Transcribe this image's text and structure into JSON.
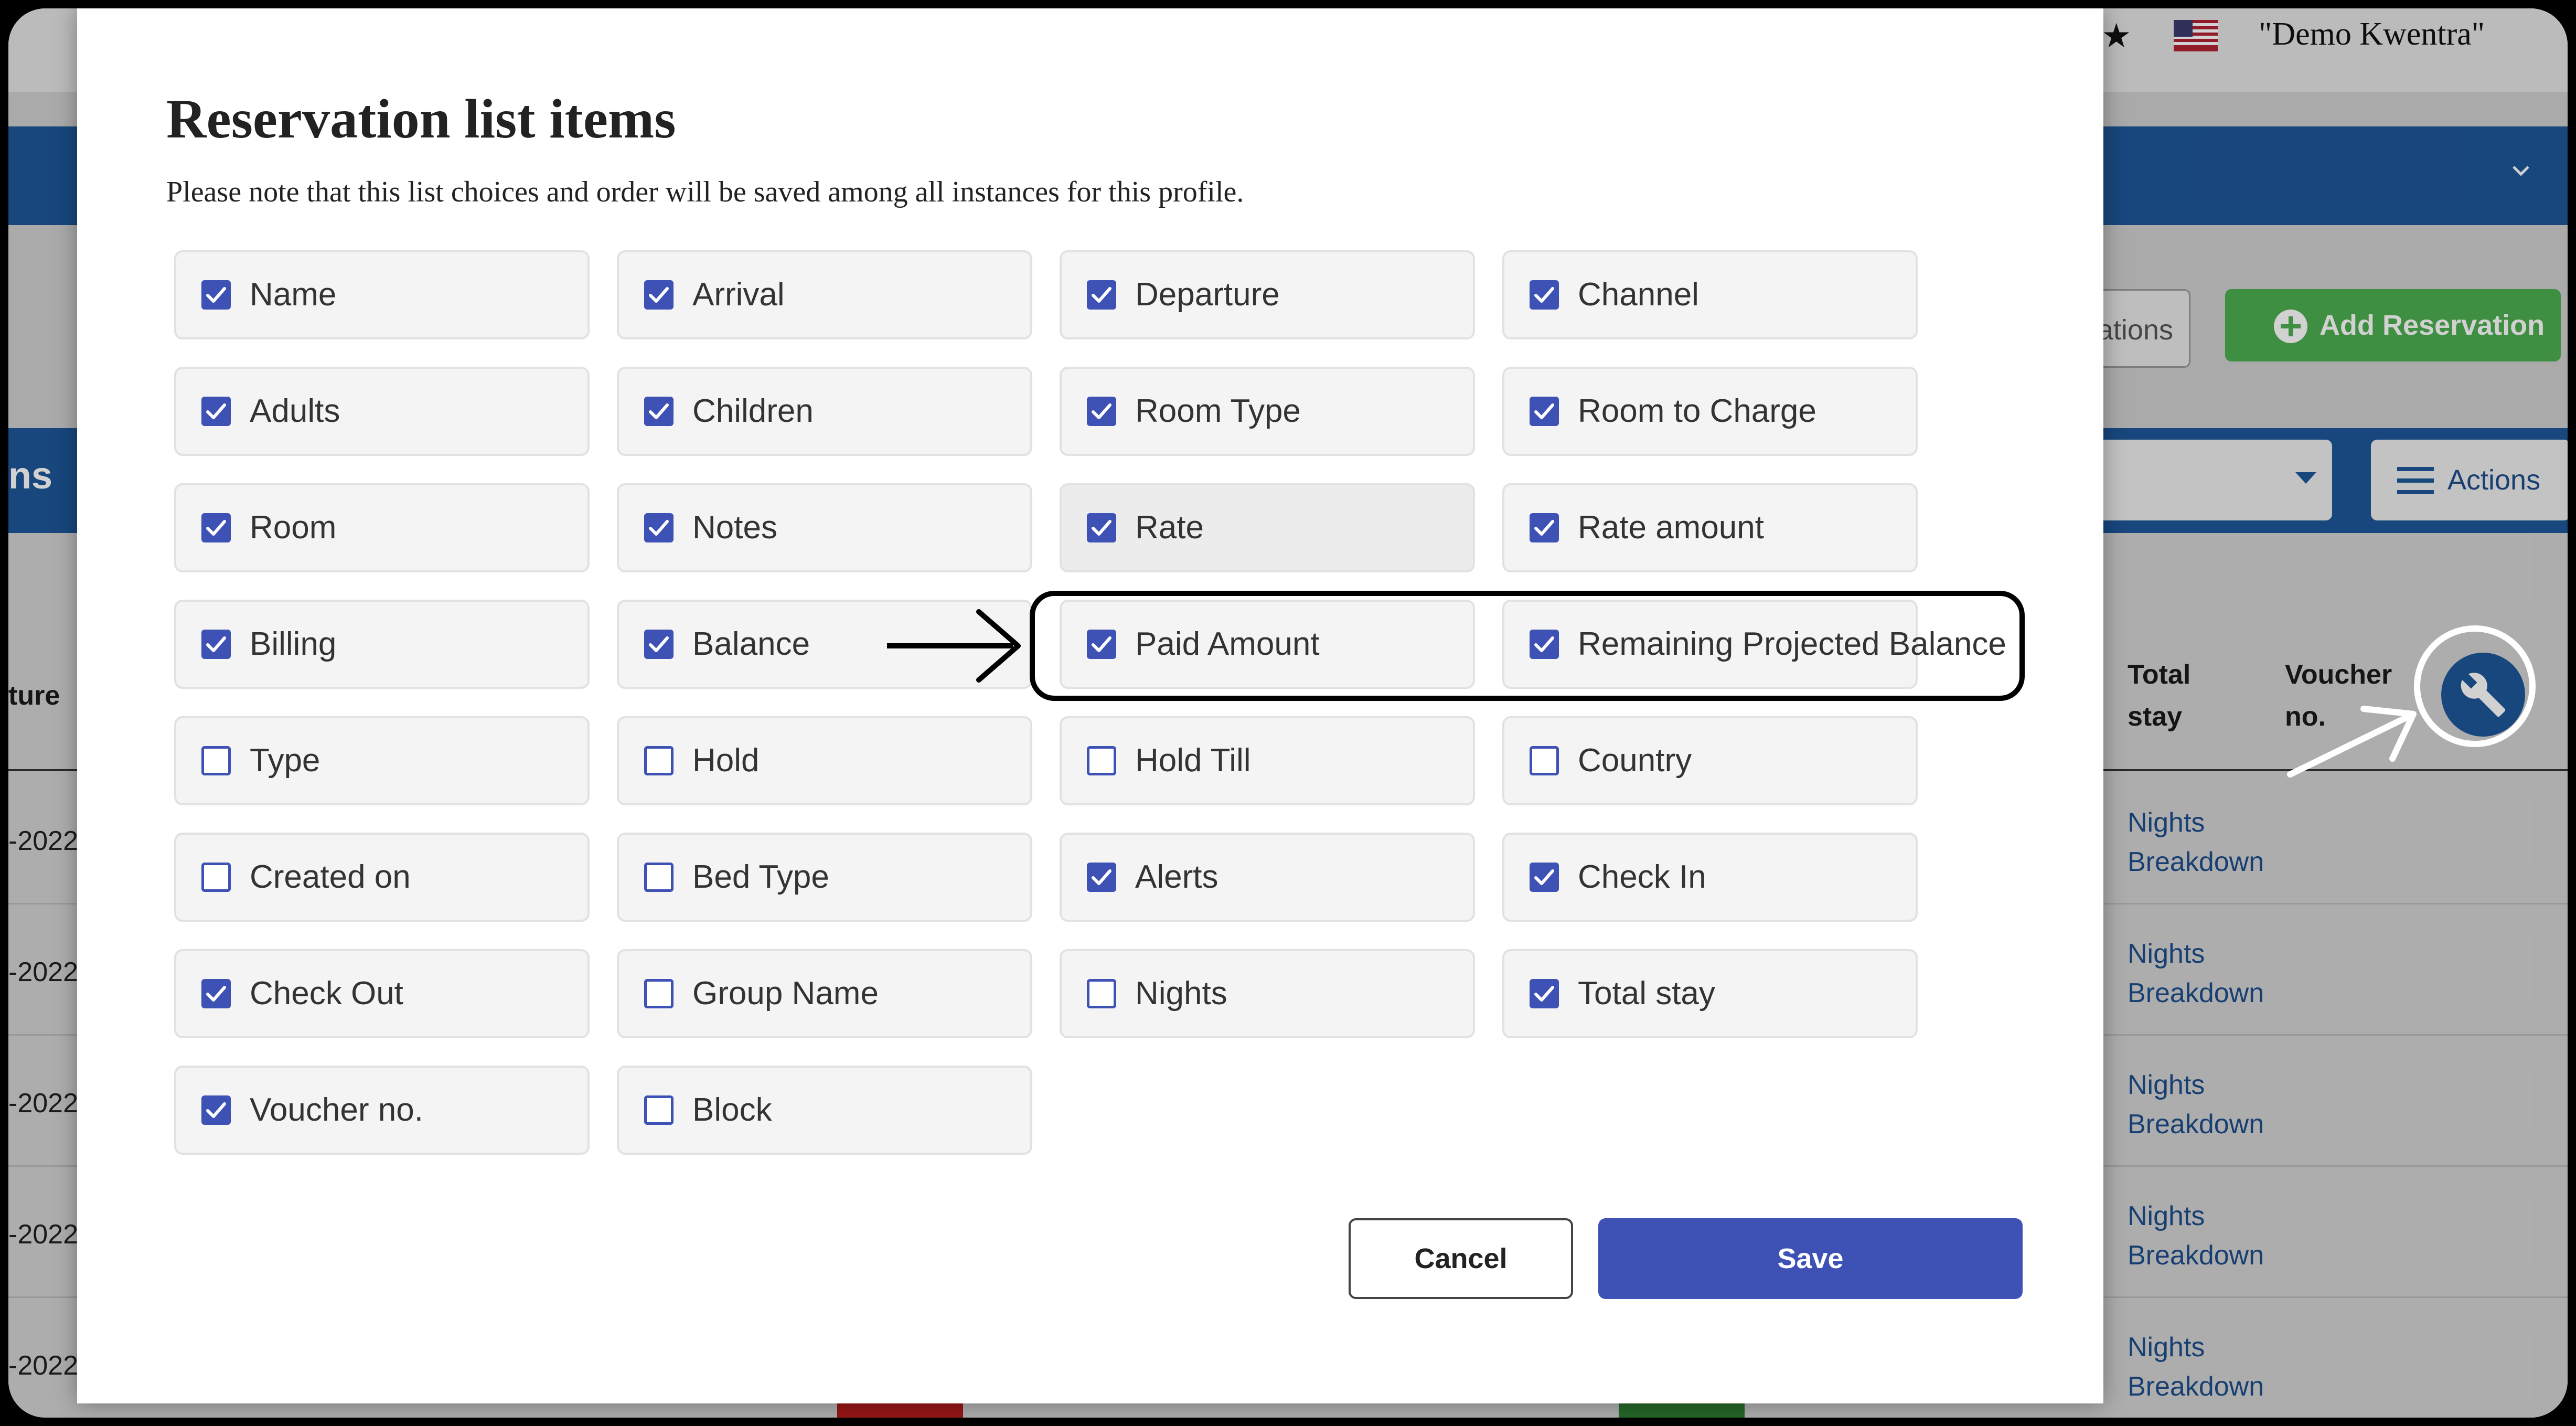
{
  "background": {
    "header_star": "★",
    "profile_name": "\"Demo Kwentra\"",
    "reservations_partial": "ations",
    "add_reservation": "Add Reservation",
    "section_partial": "ns",
    "actions_label": "Actions",
    "col_total_stay": "Total stay",
    "col_voucher": "Voucher no.",
    "col_partial": "ture",
    "row_date_partial": "-2022",
    "nights_breakdown": "Nights Breakdown",
    "colors": {
      "blue": "#1e5799",
      "green": "#4caf50"
    }
  },
  "modal": {
    "title": "Reservation list items",
    "note": "Please note that this list choices and order will be saved among all instances for this profile.",
    "items": [
      {
        "label": "Name",
        "checked": true
      },
      {
        "label": "Arrival",
        "checked": true
      },
      {
        "label": "Departure",
        "checked": true
      },
      {
        "label": "Channel",
        "checked": true
      },
      {
        "label": "Adults",
        "checked": true
      },
      {
        "label": "Children",
        "checked": true
      },
      {
        "label": "Room Type",
        "checked": true
      },
      {
        "label": "Room to Charge",
        "checked": true
      },
      {
        "label": "Room",
        "checked": true
      },
      {
        "label": "Notes",
        "checked": true
      },
      {
        "label": "Rate",
        "checked": true
      },
      {
        "label": "Rate amount",
        "checked": true
      },
      {
        "label": "Billing",
        "checked": true
      },
      {
        "label": "Balance",
        "checked": true
      },
      {
        "label": "Paid Amount",
        "checked": true
      },
      {
        "label": "Remaining Projected Balance",
        "checked": true
      },
      {
        "label": "Type",
        "checked": false
      },
      {
        "label": "Hold",
        "checked": false
      },
      {
        "label": "Hold Till",
        "checked": false
      },
      {
        "label": "Country",
        "checked": false
      },
      {
        "label": "Created on",
        "checked": false
      },
      {
        "label": "Bed Type",
        "checked": false
      },
      {
        "label": "Alerts",
        "checked": true
      },
      {
        "label": "Check In",
        "checked": true
      },
      {
        "label": "Check Out",
        "checked": true
      },
      {
        "label": "Group Name",
        "checked": false
      },
      {
        "label": "Nights",
        "checked": false
      },
      {
        "label": "Total stay",
        "checked": true
      },
      {
        "label": "Voucher no.",
        "checked": true
      },
      {
        "label": "Block",
        "checked": false
      }
    ],
    "cancel_label": "Cancel",
    "save_label": "Save",
    "colors": {
      "accent": "#3e51b5"
    }
  }
}
